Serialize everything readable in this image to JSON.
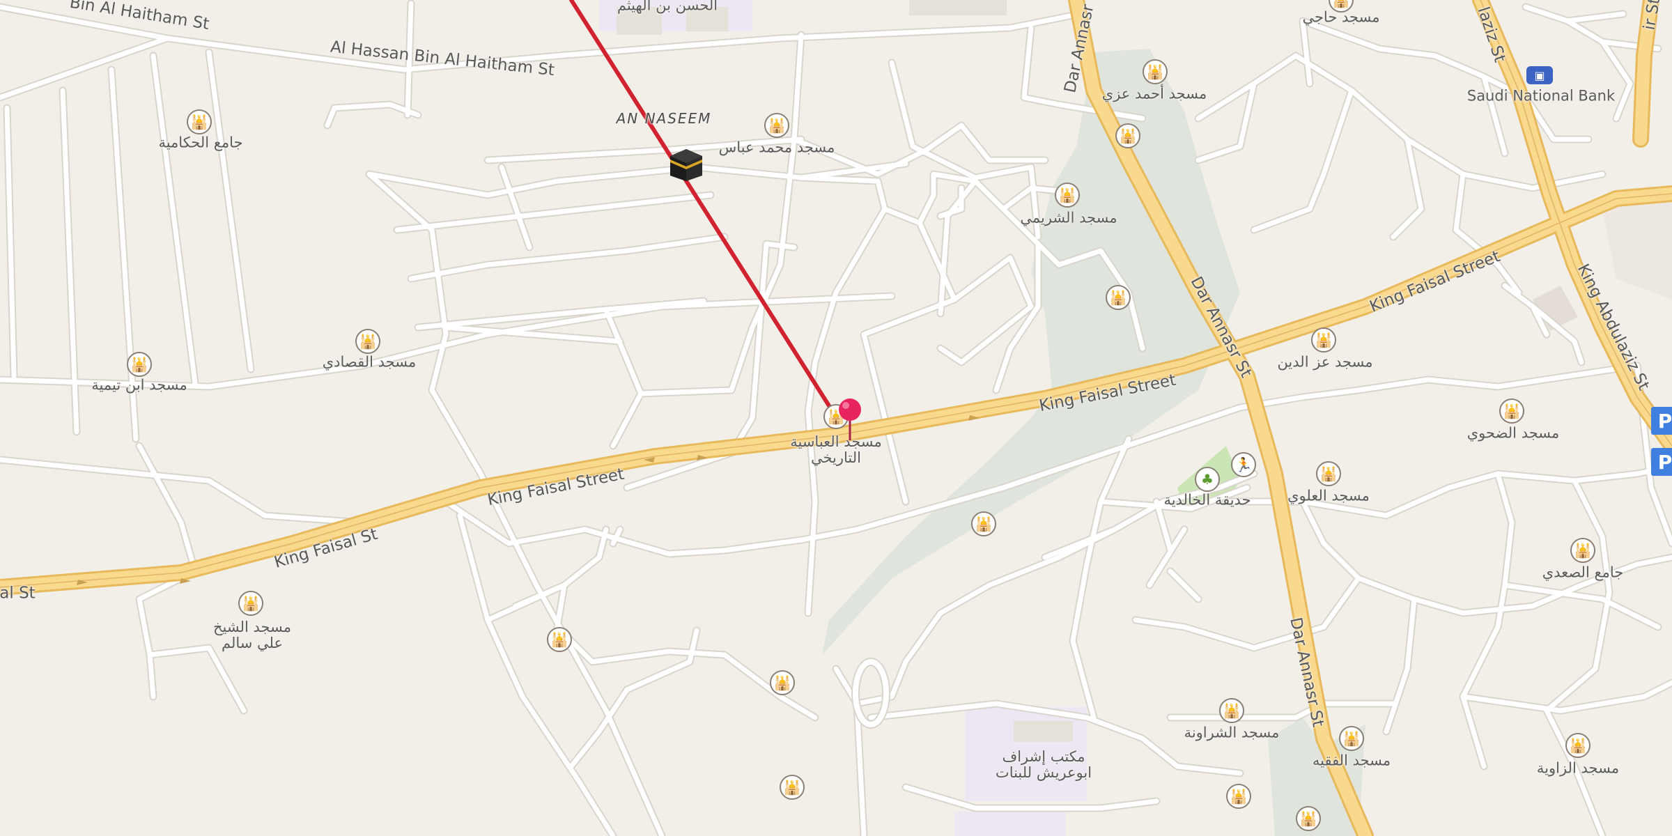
{
  "map": {
    "district": "AN NASEEM",
    "streets": {
      "haitham_1": "Bin Al Haitham St",
      "haitham_2": "Al Hassan Bin Al Haitham St",
      "faisal_1": "King Faisal Street",
      "faisal_2": "King Faisal Street",
      "faisal_3": "King Faisal Street",
      "faisal_4": "King Faisal St",
      "faisal_5": "al St",
      "annasr_1": "Dar Annasr",
      "annasr_2": "Dar Annasr St",
      "annasr_3": "Dar Annasr St",
      "abdulaziz_1": "King Abdulaziz St",
      "abdulaziz_2": "laziz St",
      "far_right": "ir St"
    },
    "places": {
      "haitham_building": "الحسن بن الهيثم",
      "hajji": "مسجد حاجي",
      "hakamiya": "جامع الحكامية",
      "ahmed_izzi": "مسجد أحمد عزي",
      "mohammed_abbas": "مسجد محمد عباس",
      "shuraimi": "مسجد الشريمي",
      "qadi": "مسجد القصادي",
      "ibn_taymiya": "مسجد ابن تيمية",
      "abbasiya": "مسجد العباسية\nالتاريخي",
      "izz_aldin": "مسجد عز الدين",
      "duhawi": "مسجد الضحوي",
      "khalidiya_park": "حديقة الخالدية",
      "alawi": "مسجد العلوي",
      "saidi": "جامع الصعدي",
      "shaikh_ali": "مسجد الشيخ\nعلي سالم",
      "sharawna": "مسجد الشراونة",
      "faqih": "مسجد الفقيه",
      "zawiya": "مسجد الزاوية",
      "office": "مكتب إشراف\nابوعريش للبنات",
      "bank": "Saudi National Bank"
    },
    "parking_letter": "P",
    "icons": {
      "mosque": "mosque-icon",
      "park": "tree-icon",
      "playground": "running-person-icon",
      "bank": "bank-icon",
      "kaaba": "kaaba-qibla-icon",
      "pin": "location-pin-icon"
    },
    "colors": {
      "land": "#f2efe9",
      "street": "#ffffff",
      "street_casing": "#d8d4cc",
      "major_road": "#f8d98e",
      "major_casing": "#e8b95a",
      "green": "#dfe4dc",
      "park": "#c9e6b4",
      "campus": "#ece7f3",
      "qibla_line": "#d1232f",
      "pin": "#e8245e",
      "bank": "#3b63c4",
      "parking": "#3f7fe0"
    }
  }
}
